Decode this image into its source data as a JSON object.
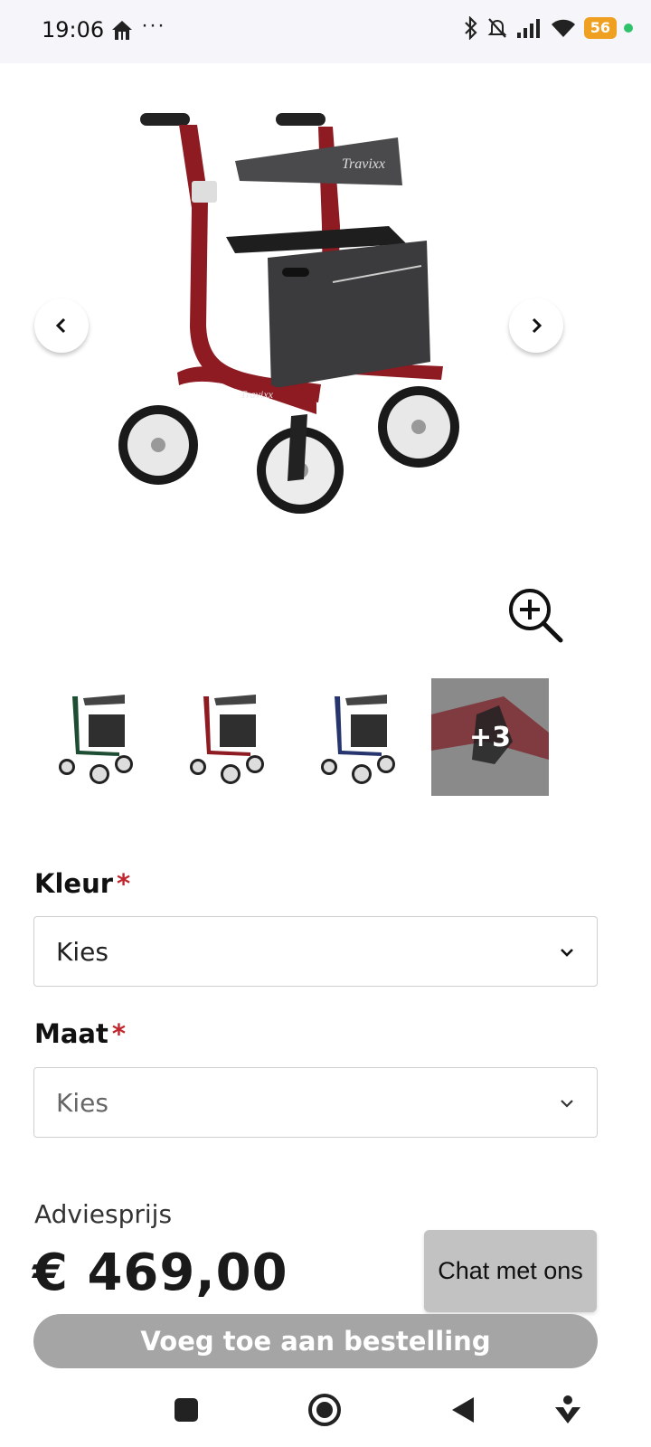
{
  "status_bar": {
    "time": "19:06",
    "dots": "···",
    "battery": "56"
  },
  "gallery": {
    "more_count": "+3"
  },
  "form": {
    "kleur_label": "Kleur",
    "kleur_value": "Kies",
    "maat_label": "Maat",
    "maat_value": "Kies",
    "required_mark": "*"
  },
  "price": {
    "label": "Adviesprijs",
    "value": "€ 469,00"
  },
  "chat_label": "Chat met ons",
  "add_button_label": "Voeg toe aan bestelling",
  "colors": {
    "required": "#c0262d",
    "button_disabled": "#a5a5a5",
    "frame_red": "#8e1a22",
    "frame_green": "#1d4d33",
    "frame_blue": "#27356e"
  }
}
